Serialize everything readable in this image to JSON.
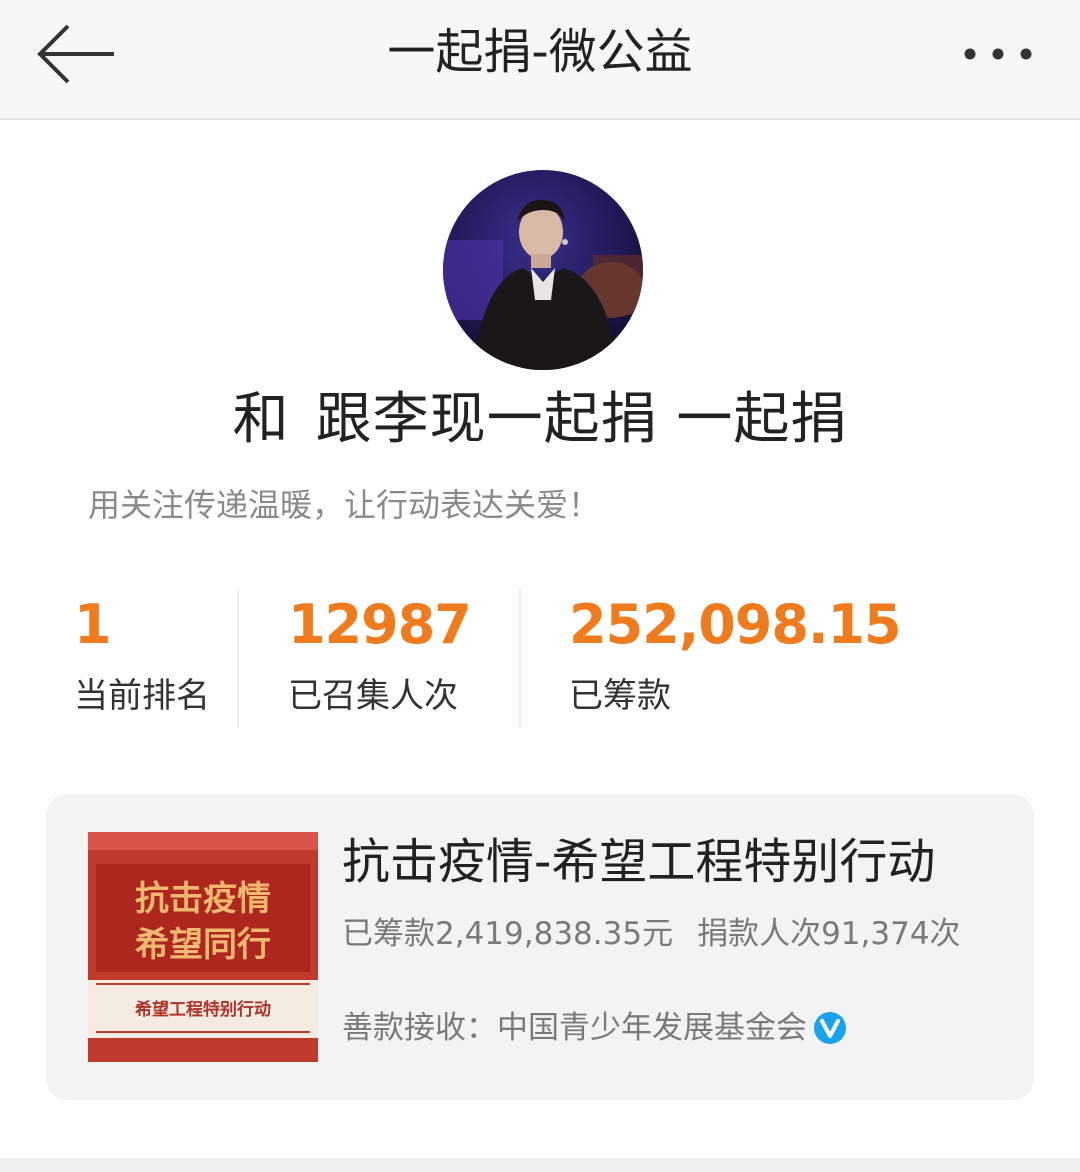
{
  "nav": {
    "title": "一起捐-微公益"
  },
  "team": {
    "name_prefix": "和",
    "name": "跟李现一起捐 一起捐",
    "slogan": "用关注传递温暖，让行动表达关爱！"
  },
  "stats": [
    {
      "value": "1",
      "label": "当前排名"
    },
    {
      "value": "12987",
      "label": "已召集人次"
    },
    {
      "value": "252,098.15",
      "label": "已筹款"
    }
  ],
  "project": {
    "name": "抗击疫情-希望工程特别行动",
    "raised": "已筹款2,419,838.35元",
    "donors": "捐款人次91,374次",
    "receiver_label": "善款接收：",
    "receiver": "中国青少年发展基金会",
    "thumbnail": {
      "line1": "抗击疫情",
      "line2": "希望同行",
      "subtitle": "希望工程特别行动"
    }
  },
  "colors": {
    "accent": "#f07b1d",
    "verified": "#1aa2f0",
    "thumb_red": "#b52d24"
  }
}
